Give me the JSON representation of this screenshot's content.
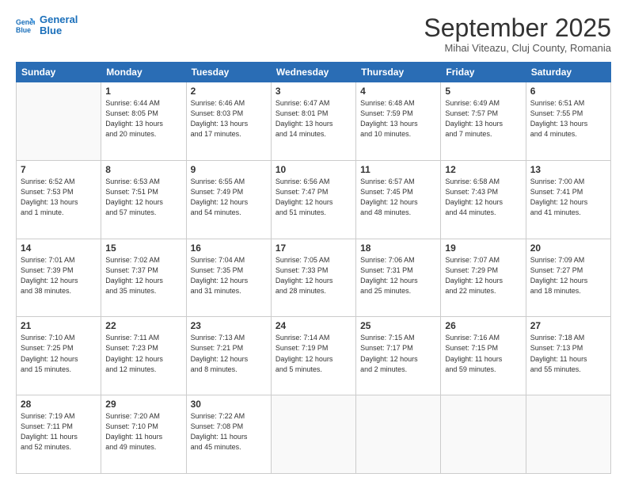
{
  "header": {
    "logo_line1": "General",
    "logo_line2": "Blue",
    "month": "September 2025",
    "location": "Mihai Viteazu, Cluj County, Romania"
  },
  "weekdays": [
    "Sunday",
    "Monday",
    "Tuesday",
    "Wednesday",
    "Thursday",
    "Friday",
    "Saturday"
  ],
  "weeks": [
    [
      {
        "day": "",
        "info": ""
      },
      {
        "day": "1",
        "info": "Sunrise: 6:44 AM\nSunset: 8:05 PM\nDaylight: 13 hours\nand 20 minutes."
      },
      {
        "day": "2",
        "info": "Sunrise: 6:46 AM\nSunset: 8:03 PM\nDaylight: 13 hours\nand 17 minutes."
      },
      {
        "day": "3",
        "info": "Sunrise: 6:47 AM\nSunset: 8:01 PM\nDaylight: 13 hours\nand 14 minutes."
      },
      {
        "day": "4",
        "info": "Sunrise: 6:48 AM\nSunset: 7:59 PM\nDaylight: 13 hours\nand 10 minutes."
      },
      {
        "day": "5",
        "info": "Sunrise: 6:49 AM\nSunset: 7:57 PM\nDaylight: 13 hours\nand 7 minutes."
      },
      {
        "day": "6",
        "info": "Sunrise: 6:51 AM\nSunset: 7:55 PM\nDaylight: 13 hours\nand 4 minutes."
      }
    ],
    [
      {
        "day": "7",
        "info": "Sunrise: 6:52 AM\nSunset: 7:53 PM\nDaylight: 13 hours\nand 1 minute."
      },
      {
        "day": "8",
        "info": "Sunrise: 6:53 AM\nSunset: 7:51 PM\nDaylight: 12 hours\nand 57 minutes."
      },
      {
        "day": "9",
        "info": "Sunrise: 6:55 AM\nSunset: 7:49 PM\nDaylight: 12 hours\nand 54 minutes."
      },
      {
        "day": "10",
        "info": "Sunrise: 6:56 AM\nSunset: 7:47 PM\nDaylight: 12 hours\nand 51 minutes."
      },
      {
        "day": "11",
        "info": "Sunrise: 6:57 AM\nSunset: 7:45 PM\nDaylight: 12 hours\nand 48 minutes."
      },
      {
        "day": "12",
        "info": "Sunrise: 6:58 AM\nSunset: 7:43 PM\nDaylight: 12 hours\nand 44 minutes."
      },
      {
        "day": "13",
        "info": "Sunrise: 7:00 AM\nSunset: 7:41 PM\nDaylight: 12 hours\nand 41 minutes."
      }
    ],
    [
      {
        "day": "14",
        "info": "Sunrise: 7:01 AM\nSunset: 7:39 PM\nDaylight: 12 hours\nand 38 minutes."
      },
      {
        "day": "15",
        "info": "Sunrise: 7:02 AM\nSunset: 7:37 PM\nDaylight: 12 hours\nand 35 minutes."
      },
      {
        "day": "16",
        "info": "Sunrise: 7:04 AM\nSunset: 7:35 PM\nDaylight: 12 hours\nand 31 minutes."
      },
      {
        "day": "17",
        "info": "Sunrise: 7:05 AM\nSunset: 7:33 PM\nDaylight: 12 hours\nand 28 minutes."
      },
      {
        "day": "18",
        "info": "Sunrise: 7:06 AM\nSunset: 7:31 PM\nDaylight: 12 hours\nand 25 minutes."
      },
      {
        "day": "19",
        "info": "Sunrise: 7:07 AM\nSunset: 7:29 PM\nDaylight: 12 hours\nand 22 minutes."
      },
      {
        "day": "20",
        "info": "Sunrise: 7:09 AM\nSunset: 7:27 PM\nDaylight: 12 hours\nand 18 minutes."
      }
    ],
    [
      {
        "day": "21",
        "info": "Sunrise: 7:10 AM\nSunset: 7:25 PM\nDaylight: 12 hours\nand 15 minutes."
      },
      {
        "day": "22",
        "info": "Sunrise: 7:11 AM\nSunset: 7:23 PM\nDaylight: 12 hours\nand 12 minutes."
      },
      {
        "day": "23",
        "info": "Sunrise: 7:13 AM\nSunset: 7:21 PM\nDaylight: 12 hours\nand 8 minutes."
      },
      {
        "day": "24",
        "info": "Sunrise: 7:14 AM\nSunset: 7:19 PM\nDaylight: 12 hours\nand 5 minutes."
      },
      {
        "day": "25",
        "info": "Sunrise: 7:15 AM\nSunset: 7:17 PM\nDaylight: 12 hours\nand 2 minutes."
      },
      {
        "day": "26",
        "info": "Sunrise: 7:16 AM\nSunset: 7:15 PM\nDaylight: 11 hours\nand 59 minutes."
      },
      {
        "day": "27",
        "info": "Sunrise: 7:18 AM\nSunset: 7:13 PM\nDaylight: 11 hours\nand 55 minutes."
      }
    ],
    [
      {
        "day": "28",
        "info": "Sunrise: 7:19 AM\nSunset: 7:11 PM\nDaylight: 11 hours\nand 52 minutes."
      },
      {
        "day": "29",
        "info": "Sunrise: 7:20 AM\nSunset: 7:10 PM\nDaylight: 11 hours\nand 49 minutes."
      },
      {
        "day": "30",
        "info": "Sunrise: 7:22 AM\nSunset: 7:08 PM\nDaylight: 11 hours\nand 45 minutes."
      },
      {
        "day": "",
        "info": ""
      },
      {
        "day": "",
        "info": ""
      },
      {
        "day": "",
        "info": ""
      },
      {
        "day": "",
        "info": ""
      }
    ]
  ]
}
